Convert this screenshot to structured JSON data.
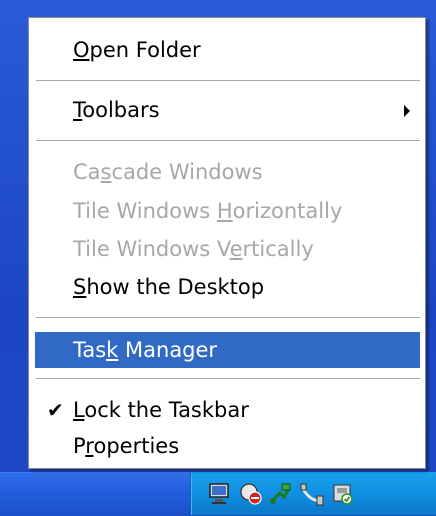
{
  "menu": {
    "open_folder": {
      "pre": "",
      "u": "O",
      "post": "pen Folder"
    },
    "toolbars": {
      "pre": "",
      "u": "T",
      "post": "oolbars"
    },
    "cascade": {
      "pre": "Ca",
      "u": "s",
      "post": "cade Windows"
    },
    "tile_h": {
      "pre": "Tile Windows ",
      "u": "H",
      "post": "orizontally"
    },
    "tile_v": {
      "pre": "Tile Windows V",
      "u": "e",
      "post": "rtically"
    },
    "show_desktop": {
      "pre": "",
      "u": "S",
      "post": "how the Desktop"
    },
    "task_manager": {
      "pre": "Tas",
      "u": "k",
      "post": " Manager"
    },
    "lock_taskbar": {
      "pre": "",
      "u": "L",
      "post": "ock the Taskbar"
    },
    "properties": {
      "pre": "P",
      "u": "r",
      "post": "operties"
    },
    "check_glyph": "✔",
    "selected_color": "#316ac5",
    "disabled_color": "#a7a7a7"
  },
  "tray": {
    "icons": [
      "network-monitor-icon",
      "security-shield-icon",
      "usb-device-icon",
      "network-cable-icon",
      "printer-status-icon"
    ]
  }
}
